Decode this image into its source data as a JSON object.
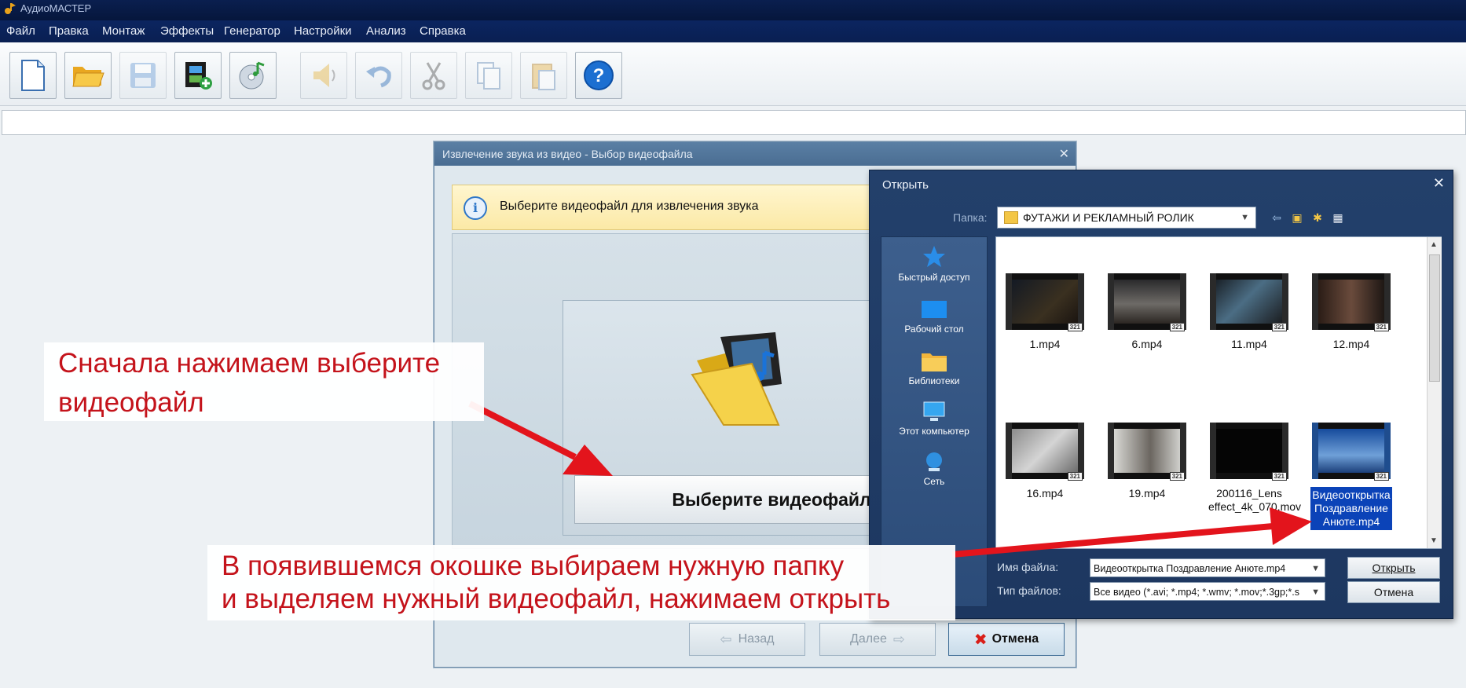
{
  "app": {
    "title": "АудиоМАСТЕР"
  },
  "menu": [
    "Файл",
    "Правка",
    "Монтаж",
    "Эффекты",
    "Генератор",
    "Настройки",
    "Анализ",
    "Справка"
  ],
  "toolbar": {
    "buttons": [
      {
        "icon": "new-file-icon",
        "enabled": true
      },
      {
        "icon": "open-folder-icon",
        "enabled": true
      },
      {
        "icon": "save-disk-icon",
        "enabled": false
      },
      {
        "icon": "video-add-icon",
        "enabled": true
      },
      {
        "icon": "cd-music-icon",
        "enabled": true
      },
      {
        "icon": "speaker-icon",
        "enabled": false
      },
      {
        "icon": "undo-icon",
        "enabled": false
      },
      {
        "icon": "cut-icon",
        "enabled": false
      },
      {
        "icon": "copy-icon",
        "enabled": false
      },
      {
        "icon": "paste-icon",
        "enabled": false
      },
      {
        "icon": "help-icon",
        "enabled": true
      }
    ]
  },
  "wizard": {
    "title": "Извлечение звука из видео - Выбор видеофайла",
    "info": "Выберите видеофайл для извлечения звука",
    "choose_button": "Выберите видеофайл",
    "back": "Назад",
    "next": "Далее",
    "cancel": "Отмена"
  },
  "open_dialog": {
    "title": "Открыть",
    "folder_label": "Папка:",
    "folder": "ФУТАЖИ И РЕКЛАМНЫЙ РОЛИК",
    "places": [
      "Быстрый доступ",
      "Рабочий стол",
      "Библиотеки",
      "Этот компьютер",
      "Сеть"
    ],
    "files": [
      {
        "name": "1.mp4",
        "selected": false
      },
      {
        "name": "6.mp4",
        "selected": false
      },
      {
        "name": "11.mp4",
        "selected": false
      },
      {
        "name": "12.mp4",
        "selected": false
      },
      {
        "name": "16.mp4",
        "selected": false
      },
      {
        "name": "19.mp4",
        "selected": false
      },
      {
        "name": "200116_Lens effect_4k_070.mov",
        "selected": false
      },
      {
        "name": "Видеооткрытка Поздравление Анюте.mp4",
        "selected": true
      }
    ],
    "filename_label": "Имя файла:",
    "filename_value": "Видеооткрытка Поздравление Анюте.mp4",
    "filetype_label": "Тип файлов:",
    "filetype_value": "Все видео (*.avi; *.mp4; *.wmv; *.mov;*.3gp;*.s",
    "open_button": "Открыть",
    "cancel_button": "Отмена"
  },
  "callouts": {
    "first": "Сначала нажимаем выберите видеофайл",
    "second_line1": "В появившемся окошке выбираем нужную папку",
    "second_line2": "и выделяем нужный видеофайл, нажимаем открыть"
  },
  "colors": {
    "callout_text": "#c4131b",
    "arrow": "#e3141c",
    "selection": "#0b43b8"
  }
}
